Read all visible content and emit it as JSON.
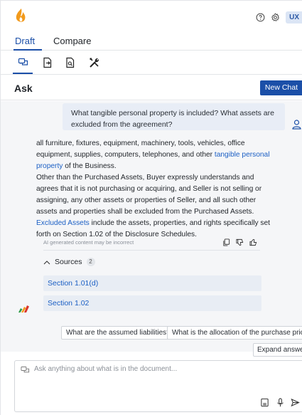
{
  "header": {
    "user_badge": "UX",
    "icons": [
      "logo-flame-icon",
      "help-icon",
      "gear-icon"
    ]
  },
  "tabs": [
    {
      "label": "Draft",
      "active": true
    },
    {
      "label": "Compare",
      "active": false
    }
  ],
  "tools": [
    "chat-tool-icon",
    "document-export-icon",
    "document-search-icon",
    "tools-icon"
  ],
  "ask": {
    "title": "Ask",
    "new_chat_label": "New Chat"
  },
  "conversation": {
    "question": "What tangible personal property is included? What assets are excluded from the agreement?",
    "answer": {
      "p1_before": "all furniture, fixtures, equipment, machinery, tools, vehicles, office equipment, supplies, computers, telephones, and other ",
      "p1_link": "tangible personal property",
      "p1_after": " of the Business.",
      "p2_before": "Other than the Purchased Assets, Buyer expressly understands and agrees that it is not purchasing or acquiring, and Seller is not selling or assigning, any other assets or properties of Seller, and all such other assets and properties shall be excluded from the Purchased Assets. ",
      "p2_link": "Excluded Assets",
      "p2_after": " include the assets, properties, and rights specifically set forth on Section 1.02 of the Disclosure Schedules."
    },
    "disclaimer": "AI generated content may be incorrect",
    "sources_label": "Sources",
    "sources_count": "2",
    "sources": [
      "Section 1.01(d)",
      "Section 1.02"
    ]
  },
  "suggestions": [
    "What are the assumed liabilities?",
    "What is the allocation of the purchase price?"
  ],
  "expand_label": "Expand answer",
  "input": {
    "placeholder": "Ask anything about what is in the document...",
    "value": ""
  },
  "colors": {
    "accent": "#1b4fa8",
    "link": "#1b5fc4",
    "chat_bg": "#f5f6f8"
  }
}
